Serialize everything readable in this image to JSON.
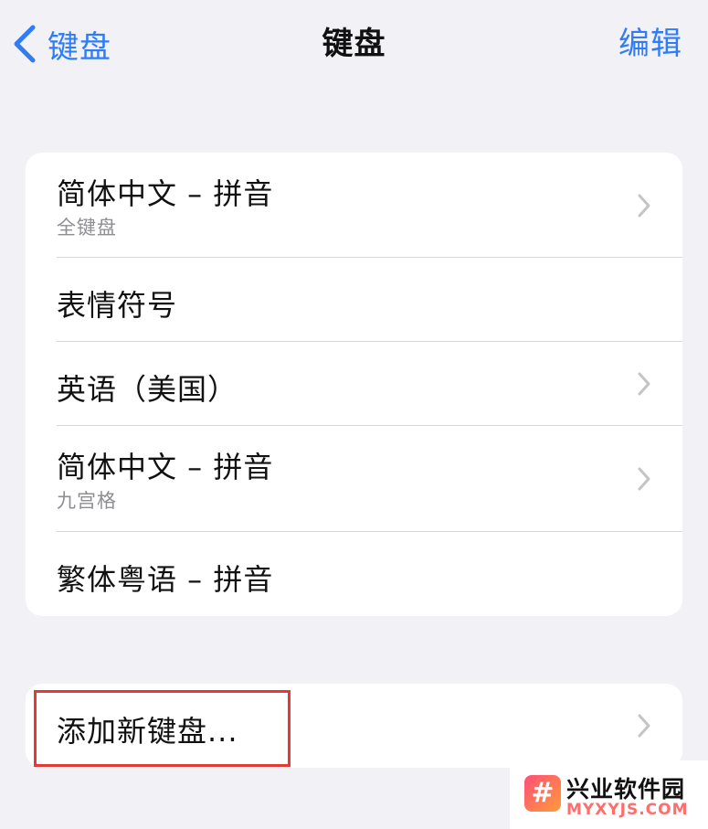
{
  "nav": {
    "back_label": "键盘",
    "title": "键盘",
    "edit_label": "编辑"
  },
  "keyboards": [
    {
      "title": "简体中文 – 拼音",
      "subtitle": "全键盘",
      "chevron": true
    },
    {
      "title": "表情符号",
      "subtitle": "",
      "chevron": false
    },
    {
      "title": "英语（美国）",
      "subtitle": "",
      "chevron": true
    },
    {
      "title": "简体中文 – 拼音",
      "subtitle": "九宫格",
      "chevron": true
    },
    {
      "title": "繁体粤语 – 拼音",
      "subtitle": "",
      "chevron": false
    }
  ],
  "add_keyboard": {
    "label": "添加新键盘..."
  },
  "watermark": {
    "logo_glyph": "#",
    "title": "兴业软件园",
    "subtitle": "MYXYJS.COM"
  },
  "colors": {
    "accent": "#2f7cf6",
    "highlight_border": "#e53935",
    "background": "#f1f1f6"
  }
}
